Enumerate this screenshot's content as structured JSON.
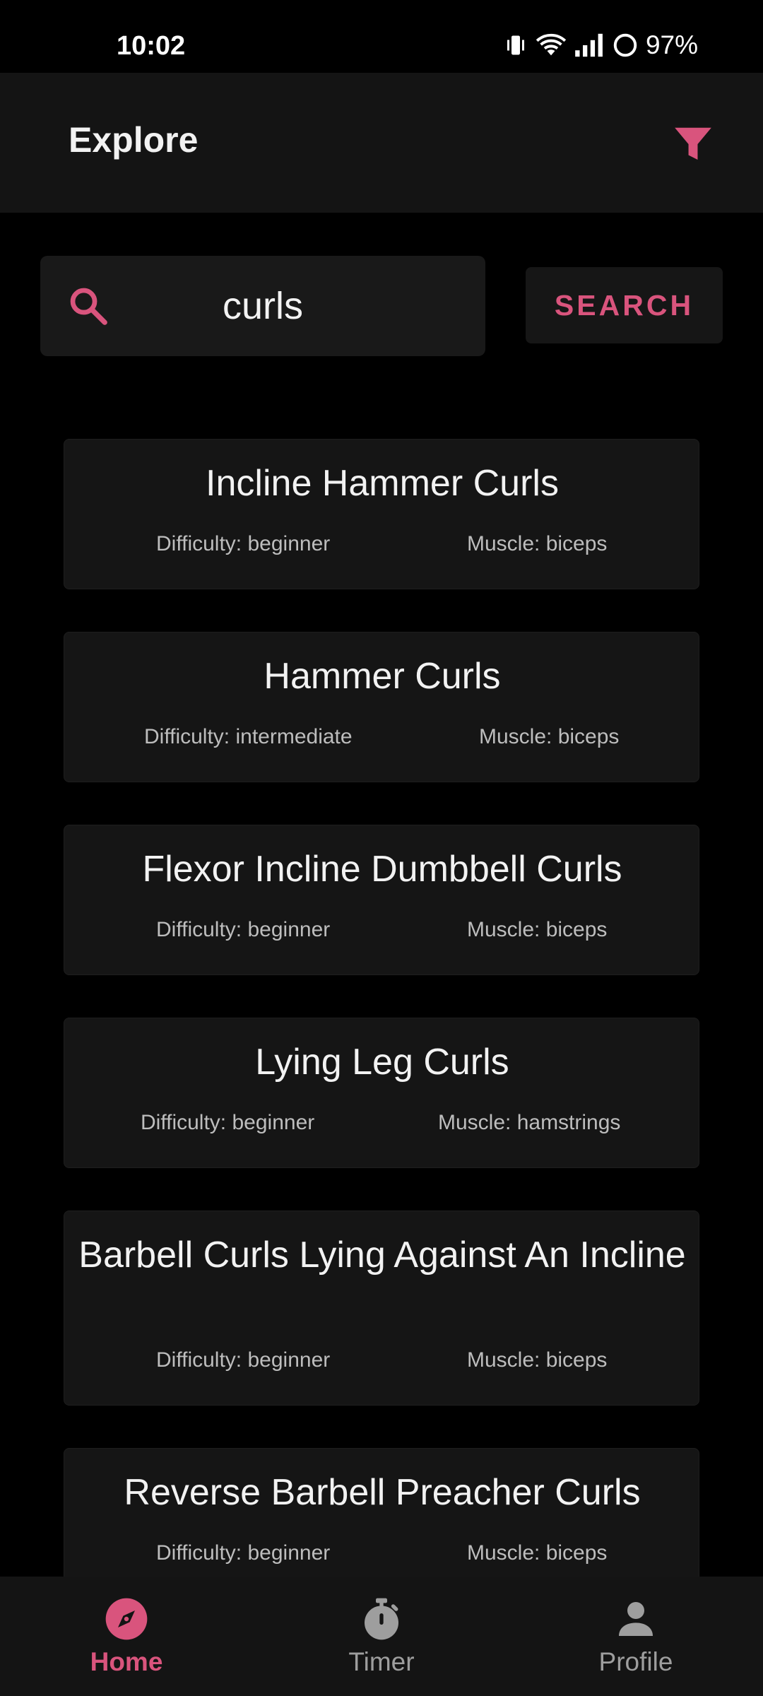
{
  "status_bar": {
    "time": "10:02",
    "battery": "97%",
    "icons": [
      "vibrate-icon",
      "wifi-icon",
      "signal-icon",
      "battery-icon"
    ]
  },
  "app_bar": {
    "title": "Explore",
    "filter_icon": "filter-icon"
  },
  "search": {
    "value": "curls",
    "button_label": "SEARCH",
    "icon": "search-icon"
  },
  "colors": {
    "accent": "#d9547d",
    "background": "#000000",
    "surface": "#151515"
  },
  "results": [
    {
      "title": "Incline Hammer Curls",
      "difficulty": "Difficulty: beginner",
      "muscle": "Muscle: biceps"
    },
    {
      "title": "Hammer Curls",
      "difficulty": "Difficulty: intermediate",
      "muscle": "Muscle: biceps"
    },
    {
      "title": "Flexor Incline Dumbbell Curls",
      "difficulty": "Difficulty: beginner",
      "muscle": "Muscle: biceps"
    },
    {
      "title": "Lying Leg Curls",
      "difficulty": "Difficulty: beginner",
      "muscle": "Muscle: hamstrings"
    },
    {
      "title": "Barbell Curls Lying Against An Incline",
      "difficulty": "Difficulty: beginner",
      "muscle": "Muscle: biceps"
    },
    {
      "title": "Reverse Barbell Preacher Curls",
      "difficulty": "Difficulty: beginner",
      "muscle": "Muscle: biceps"
    }
  ],
  "bottom_nav": [
    {
      "label": "Home",
      "icon": "compass-icon",
      "active": true
    },
    {
      "label": "Timer",
      "icon": "stopwatch-icon",
      "active": false
    },
    {
      "label": "Profile",
      "icon": "person-icon",
      "active": false
    }
  ]
}
